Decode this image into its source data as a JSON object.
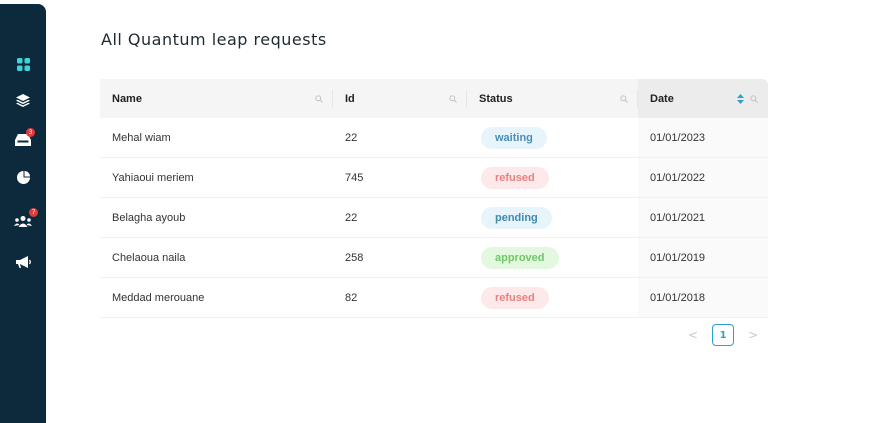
{
  "sidebar": {
    "items": [
      {
        "icon": "dashboard-grid-icon"
      },
      {
        "icon": "layers-icon"
      },
      {
        "icon": "inbox-icon",
        "badge": "3"
      },
      {
        "icon": "pie-chart-icon"
      },
      {
        "icon": "users-icon",
        "badge": "7"
      },
      {
        "icon": "megaphone-icon"
      }
    ]
  },
  "page": {
    "title": "All Quantum leap requests"
  },
  "table": {
    "columns": [
      "Name",
      "Id",
      "Status",
      "Date"
    ],
    "rows": [
      {
        "name": "Mehal wiam",
        "id": "22",
        "status": "waiting",
        "date": "01/01/2023"
      },
      {
        "name": "Yahiaoui meriem",
        "id": "745",
        "status": "refused",
        "date": "01/01/2022"
      },
      {
        "name": "Belagha ayoub",
        "id": "22",
        "status": "pending",
        "date": "01/01/2021"
      },
      {
        "name": "Chelaoua naila",
        "id": "258",
        "status": "approved",
        "date": "01/01/2019"
      },
      {
        "name": "Meddad merouane",
        "id": "82",
        "status": "refused",
        "date": "01/01/2018"
      }
    ]
  },
  "pagination": {
    "current": "1",
    "prev": "<",
    "next": ">"
  },
  "colors": {
    "sidebar": "#0d2a3d",
    "accent": "#2f9fd0",
    "badge": "#e03b3b",
    "waiting": "#4a8fb7",
    "refused": "#ea7f7f",
    "pending": "#3f89b2",
    "approved": "#6fc76a"
  }
}
